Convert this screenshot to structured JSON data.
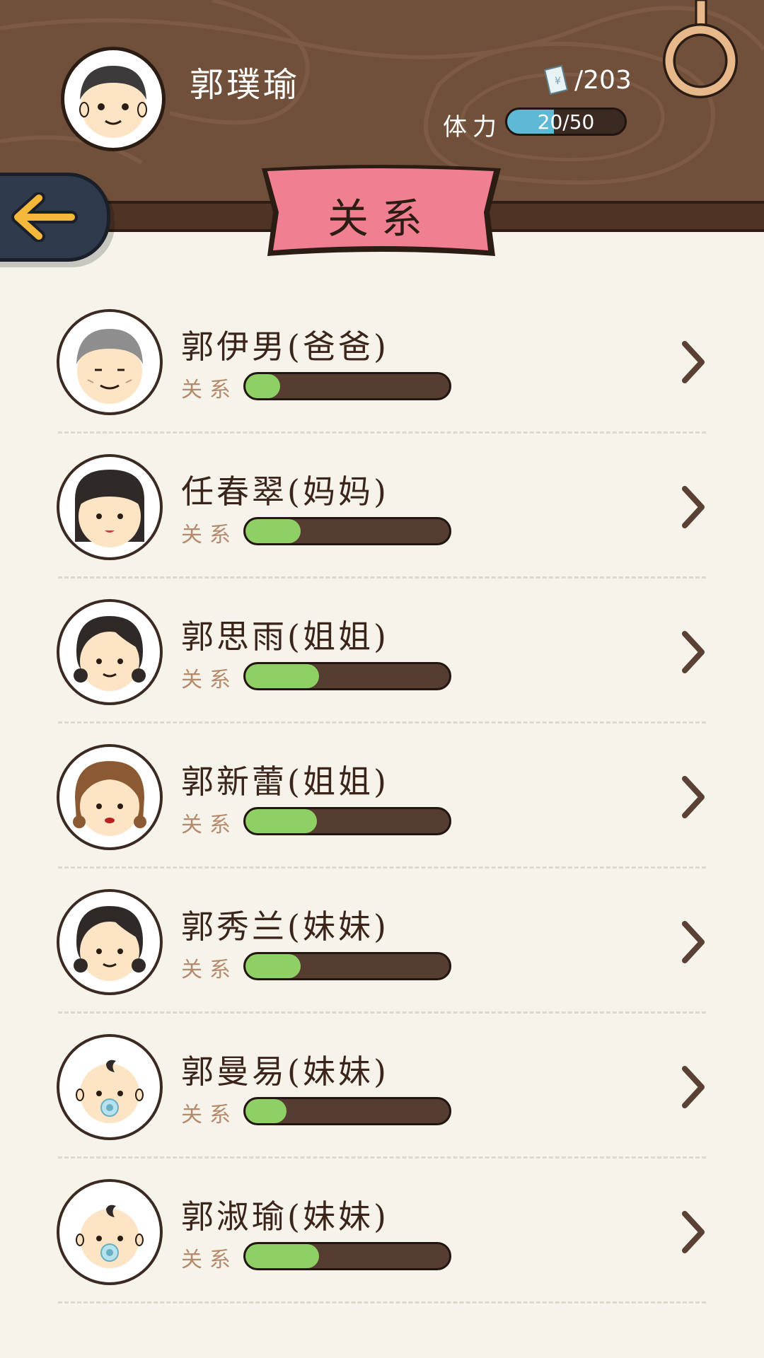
{
  "header": {
    "player_name": "郭璞瑜",
    "money_icon": "banknote-icon",
    "money": "/203",
    "stamina_label": "体力",
    "stamina_text": "20/50",
    "stamina_fraction": 0.4,
    "settings_icon": "ring-icon",
    "back_icon": "back-arrow-icon"
  },
  "banner": {
    "title": "关系"
  },
  "relations": [
    {
      "name": "郭伊男(爸爸)",
      "label": "关系",
      "level": 0.17,
      "avatar": "grandpa"
    },
    {
      "name": "任春翠(妈妈)",
      "label": "关系",
      "level": 0.27,
      "avatar": "mother"
    },
    {
      "name": "郭思雨(姐姐)",
      "label": "关系",
      "level": 0.36,
      "avatar": "girl-dark"
    },
    {
      "name": "郭新蕾(姐姐)",
      "label": "关系",
      "level": 0.35,
      "avatar": "girl-brown"
    },
    {
      "name": "郭秀兰(妹妹)",
      "label": "关系",
      "level": 0.27,
      "avatar": "girl-dark"
    },
    {
      "name": "郭曼易(妹妹)",
      "label": "关系",
      "level": 0.2,
      "avatar": "baby"
    },
    {
      "name": "郭淑瑜(妹妹)",
      "label": "关系",
      "level": 0.36,
      "avatar": "baby"
    }
  ],
  "colors": {
    "wood": "#70503a",
    "banner": "#f07f92",
    "bar_fill": "#8fd064",
    "stamina_fill": "#5db9d6",
    "accent_arrow": "#f6b83a"
  }
}
